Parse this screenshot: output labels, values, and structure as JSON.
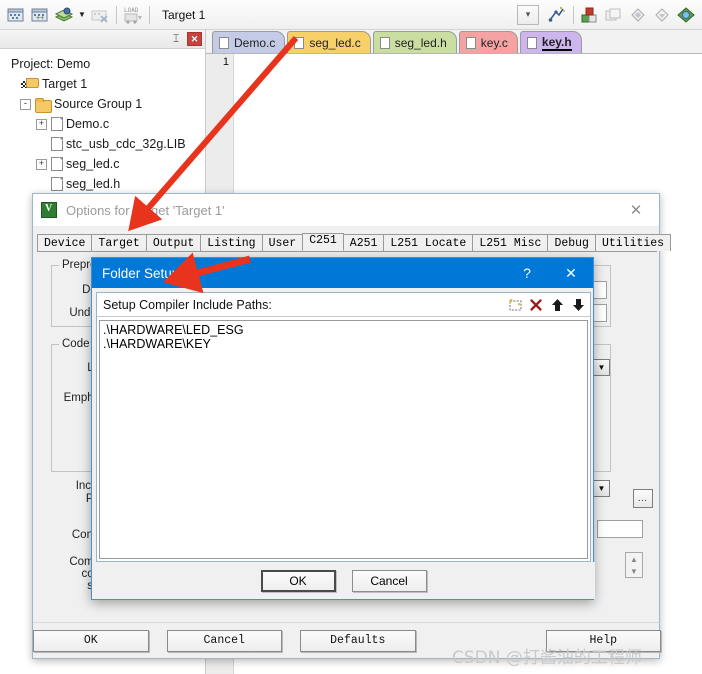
{
  "toolbar": {
    "icons": [
      "build-target-icon",
      "rebuild-all-icon",
      "batch-build-icon",
      "batch-build-dropdown-icon",
      "stop-build-icon",
      "load-icon"
    ],
    "target_name": "Target 1",
    "target_dropdown_icon": "chevron-down-icon",
    "right_icons": [
      "options-for-target-icon",
      "manage-project-items-icon",
      "books-icon",
      "source-browser-icon",
      "find-in-files-icon",
      "configuration-wizard-icon"
    ]
  },
  "project_panel": {
    "pin_icon": "pin-icon",
    "close_icon": "close-icon",
    "title": "Project: Demo",
    "tree": [
      {
        "label": "Target 1",
        "icon": "target-icon",
        "indent": 1,
        "expander": ""
      },
      {
        "label": "Source Group 1",
        "icon": "folder-icon",
        "indent": 2,
        "expander": "-"
      },
      {
        "label": "Demo.c",
        "icon": "file-icon",
        "indent": 3,
        "expander": "+"
      },
      {
        "label": "stc_usb_cdc_32g.LIB",
        "icon": "file-icon",
        "indent": 3,
        "expander": ""
      },
      {
        "label": "seg_led.c",
        "icon": "file-icon",
        "indent": 3,
        "expander": "+"
      },
      {
        "label": "seg_led.h",
        "icon": "file-icon",
        "indent": 3,
        "expander": ""
      }
    ]
  },
  "editor": {
    "tabs": [
      {
        "label": "Demo.c",
        "color": "#c3cbe6",
        "active": false
      },
      {
        "label": "seg_led.c",
        "color": "#f8d06a",
        "active": false
      },
      {
        "label": "seg_led.h",
        "color": "#c9dea0",
        "active": false
      },
      {
        "label": "key.c",
        "color": "#f4a2a2",
        "active": false
      },
      {
        "label": "key.h",
        "color": "#cdb6ee",
        "active": true
      }
    ],
    "line_number": "1"
  },
  "options_dialog": {
    "icon": "keil-logo-icon",
    "title": "Options for Target 'Target 1'",
    "close_icon": "close-icon",
    "tabs": [
      {
        "label": "Device",
        "selected": false
      },
      {
        "label": "Target",
        "selected": false
      },
      {
        "label": "Output",
        "selected": false
      },
      {
        "label": "Listing",
        "selected": false
      },
      {
        "label": "User",
        "selected": false
      },
      {
        "label": "C251",
        "selected": true
      },
      {
        "label": "A251",
        "selected": false
      },
      {
        "label": "L251 Locate",
        "selected": false
      },
      {
        "label": "L251 Misc",
        "selected": false
      },
      {
        "label": "Debug",
        "selected": false
      },
      {
        "label": "Utilities",
        "selected": false
      }
    ],
    "groups": [
      {
        "caption": "Prepro"
      },
      {
        "caption": "Code"
      }
    ],
    "labels": [
      "Def",
      "Undef",
      "Le",
      "Empha",
      "Inclu",
      "Pa",
      "M",
      "Contr",
      "Comp",
      "con",
      "str"
    ],
    "buttons": [
      {
        "label": "OK"
      },
      {
        "label": "Cancel"
      },
      {
        "label": "Defaults"
      },
      {
        "label": "Help"
      }
    ]
  },
  "folder_setup_dialog": {
    "title": "Folder Setup",
    "help_icon": "question-mark-icon",
    "close_icon": "close-icon",
    "list_label": "Setup Compiler Include Paths:",
    "toolbar": [
      {
        "icon": "new-path-icon",
        "name": "new-folder-button"
      },
      {
        "icon": "delete-icon",
        "name": "delete-path-button"
      },
      {
        "icon": "arrow-up-icon",
        "name": "move-up-button"
      },
      {
        "icon": "arrow-down-icon",
        "name": "move-down-button"
      }
    ],
    "paths": [
      ".\\HARDWARE\\LED_ESG",
      ".\\HARDWARE\\KEY"
    ],
    "ok_label": "OK",
    "cancel_label": "Cancel"
  },
  "watermark": "CSDN @打酱油的工程师",
  "colors": {
    "dialog_accent": "#0078d7",
    "annotation_arrow": "#e8341c",
    "panel_bg": "#f0f0f0"
  }
}
